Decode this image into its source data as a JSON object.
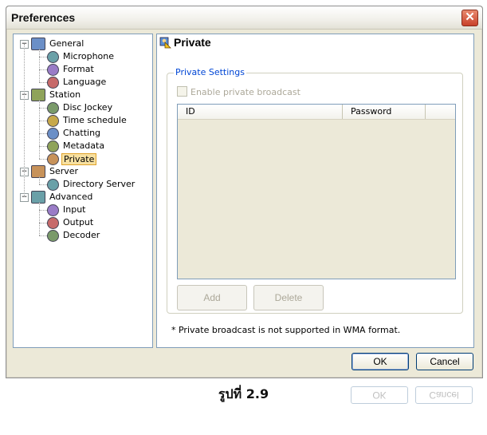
{
  "window": {
    "title": "Preferences",
    "close_glyph": "✕"
  },
  "tree": {
    "expander_glyph": "−",
    "groups": [
      {
        "label": "General",
        "icon": "general-icon",
        "children": [
          {
            "label": "Microphone",
            "icon": "microphone-icon"
          },
          {
            "label": "Format",
            "icon": "format-icon"
          },
          {
            "label": "Language",
            "icon": "language-icon"
          }
        ]
      },
      {
        "label": "Station",
        "icon": "station-icon",
        "children": [
          {
            "label": "Disc Jockey",
            "icon": "disc-jockey-icon"
          },
          {
            "label": "Time schedule",
            "icon": "time-schedule-icon"
          },
          {
            "label": "Chatting",
            "icon": "chatting-icon"
          },
          {
            "label": "Metadata",
            "icon": "metadata-icon"
          },
          {
            "label": "Private",
            "icon": "private-icon",
            "selected": true
          }
        ]
      },
      {
        "label": "Server",
        "icon": "server-icon",
        "children": [
          {
            "label": "Directory Server",
            "icon": "directory-server-icon"
          }
        ]
      },
      {
        "label": "Advanced",
        "icon": "advanced-icon",
        "children": [
          {
            "label": "Input",
            "icon": "input-icon"
          },
          {
            "label": "Output",
            "icon": "output-icon"
          },
          {
            "label": "Decoder",
            "icon": "decoder-icon"
          }
        ]
      }
    ]
  },
  "panel": {
    "title": "Private",
    "group_title": "Private Settings",
    "checkbox_label": "Enable private broadcast",
    "checkbox_checked": false,
    "columns": [
      "ID",
      "Password"
    ],
    "add_label": "Add",
    "delete_label": "Delete",
    "note": "* Private broadcast is not supported in WMA format."
  },
  "footer": {
    "ok_label": "OK",
    "cancel_label": "Cancel"
  },
  "caption": "รูปที่ 2.9",
  "colors": {
    "accent": "#0046d5",
    "selection_fill": "#f7e0a0",
    "selection_border": "#e0a22a",
    "close_red": "#c8412a"
  }
}
